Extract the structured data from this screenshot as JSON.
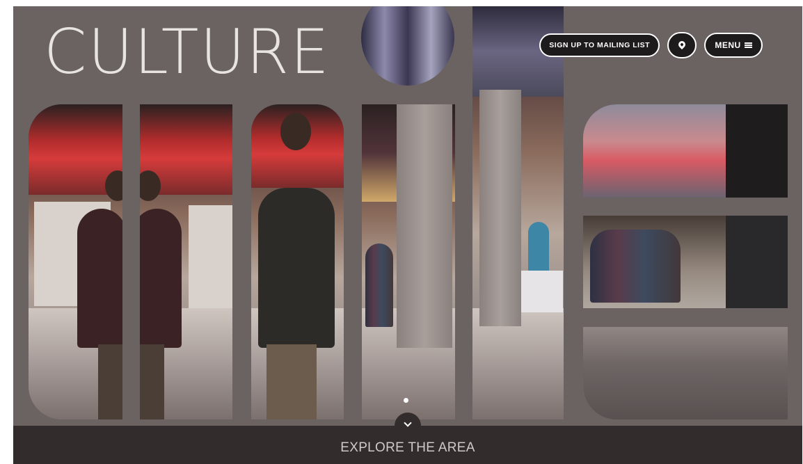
{
  "header": {
    "title": "CULTURE"
  },
  "nav": {
    "mailing_list_label": "SIGN UP TO MAILING LIST",
    "location_icon": "map-pin-icon",
    "menu_label": "MENU"
  },
  "slider": {
    "active_index": 1,
    "slide_count": 1
  },
  "footer": {
    "explore_label": "EXPLORE THE AREA",
    "down_icon": "chevron-down-icon"
  },
  "colors": {
    "background": "#6b6361",
    "footer_bar": "#322d2c",
    "title_text": "#e7e4e2",
    "button_bg": "#1d1b1b",
    "button_border": "#ffffff"
  }
}
